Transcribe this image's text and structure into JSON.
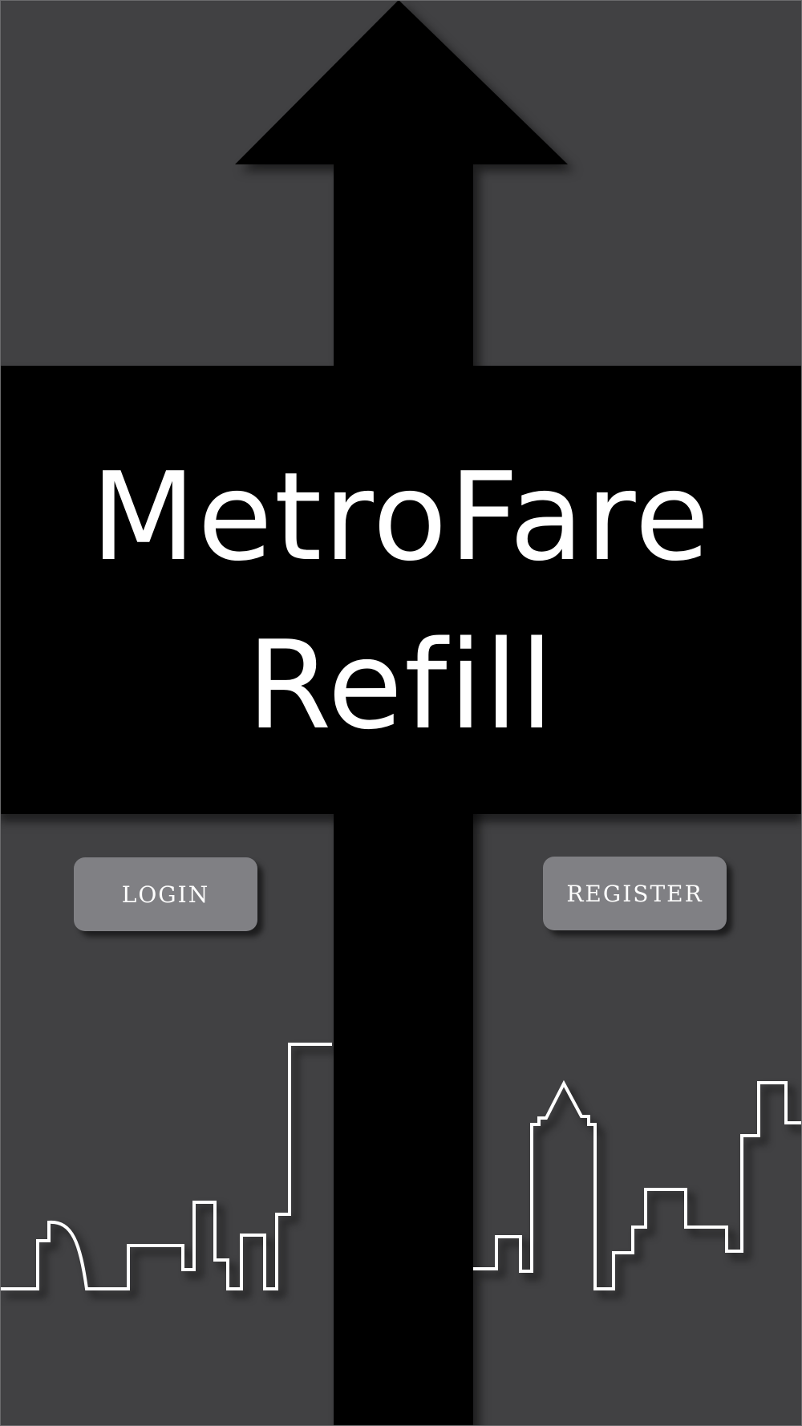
{
  "app": {
    "title_line_1": "MetroFare",
    "title_line_2": "Refill"
  },
  "actions": {
    "login_label": "LOGIN",
    "register_label": "REGISTER"
  },
  "icons": {
    "arrow": "up-arrow-icon",
    "skyline": "city-skyline-icon"
  },
  "colors": {
    "background": "#414143",
    "arrow": "#000000",
    "title_text": "#ffffff",
    "button_fill": "#808084",
    "button_text": "#ffffff",
    "skyline_stroke": "#ffffff"
  }
}
